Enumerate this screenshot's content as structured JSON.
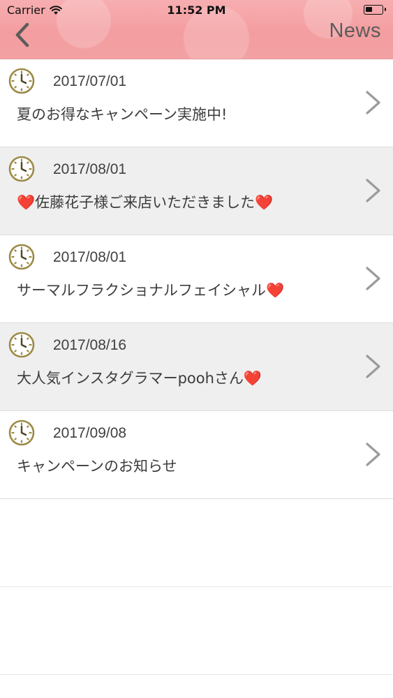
{
  "status_bar": {
    "carrier": "Carrier",
    "time": "11:52 PM"
  },
  "nav": {
    "title": "News"
  },
  "news": [
    {
      "date": "2017/07/01",
      "title": "夏のお得なキャンペーン実施中!"
    },
    {
      "date": "2017/08/01",
      "title": "❤️佐藤花子様ご来店いただきました❤️"
    },
    {
      "date": "2017/08/01",
      "title": "サーマルフラクショナルフェイシャル❤️"
    },
    {
      "date": "2017/08/16",
      "title": "大人気インスタグラマーpoohさん❤️"
    },
    {
      "date": "2017/09/08",
      "title": "キャンペーンのお知らせ"
    }
  ],
  "colors": {
    "header_pink": "#f39da0",
    "icon_olive": "#9a8a45",
    "alt_row": "#efefef",
    "chevron": "#9b9b9b"
  }
}
